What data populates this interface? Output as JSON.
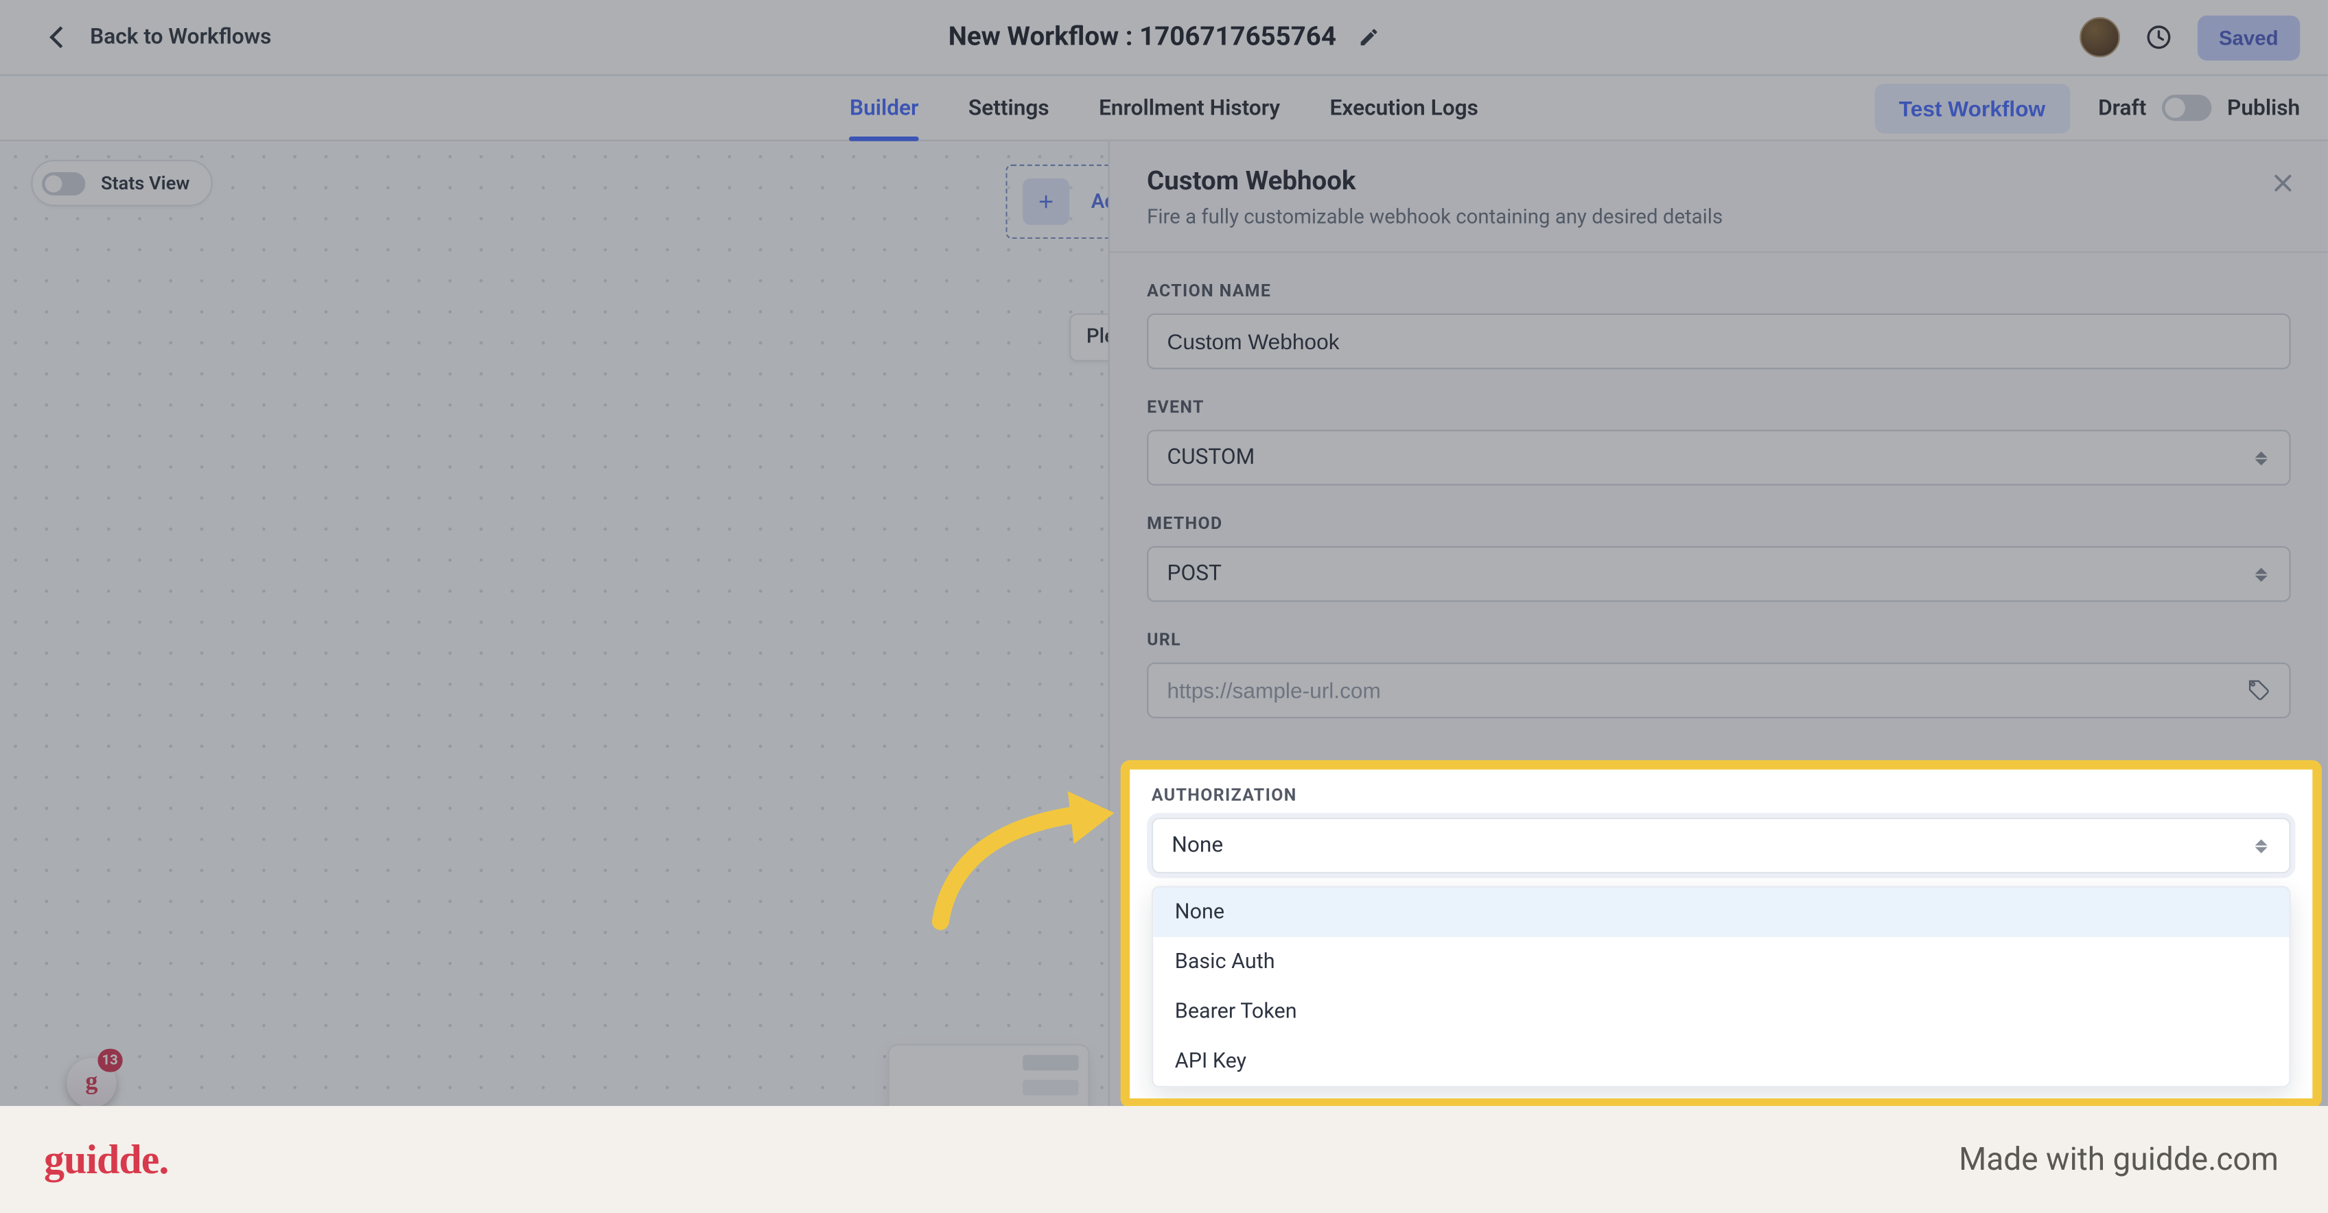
{
  "header": {
    "back_label": "Back to Workflows",
    "title": "New Workflow : 1706717655764",
    "saved_label": "Saved"
  },
  "tabs": {
    "builder": "Builder",
    "settings": "Settings",
    "enrollment": "Enrollment History",
    "execution": "Execution Logs",
    "test_label": "Test Workflow",
    "draft": "Draft",
    "publish": "Publish"
  },
  "canvas": {
    "stats_label": "Stats View",
    "add_label": "Ad",
    "ple_label": "Ple"
  },
  "panel": {
    "title": "Custom Webhook",
    "subtitle": "Fire a fully customizable webhook containing any desired details",
    "action_name_label": "ACTION NAME",
    "action_name_value": "Custom Webhook",
    "event_label": "EVENT",
    "event_value": "CUSTOM",
    "method_label": "METHOD",
    "method_value": "POST",
    "url_label": "URL",
    "url_placeholder": "https://sample-url.com",
    "auth_label": "AUTHORIZATION",
    "auth_value": "None",
    "auth_options": {
      "none": "None",
      "basic": "Basic Auth",
      "bearer": "Bearer Token",
      "apikey": "API Key"
    }
  },
  "bubble": {
    "count": "13"
  },
  "footer": {
    "brand": "guidde.",
    "madewith": "Made with guidde.com"
  }
}
